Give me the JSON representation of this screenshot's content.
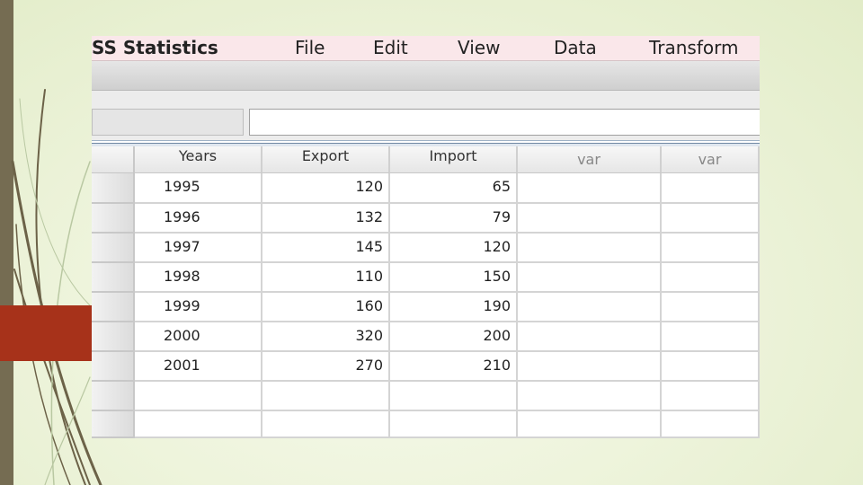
{
  "menubar": {
    "app_name": "SS Statistics",
    "items": [
      "File",
      "Edit",
      "View",
      "Data",
      "Transform"
    ]
  },
  "columns": [
    "Years",
    "Export",
    "Import",
    "var",
    "var"
  ],
  "rows": [
    [
      "1995",
      "120",
      "65"
    ],
    [
      "1996",
      "132",
      "79"
    ],
    [
      "1997",
      "145",
      "120"
    ],
    [
      "1998",
      "110",
      "150"
    ],
    [
      "1999",
      "160",
      "190"
    ],
    [
      "2000",
      "320",
      "200"
    ],
    [
      "2001",
      "270",
      "210"
    ],
    [
      "",
      "",
      ""
    ],
    [
      "",
      "",
      ""
    ]
  ],
  "colors": {
    "menubar_bg": "#fae7ea",
    "accent_block": "#a7321a",
    "left_bar": "#756c52",
    "slide_bg": "#eef4dc"
  }
}
